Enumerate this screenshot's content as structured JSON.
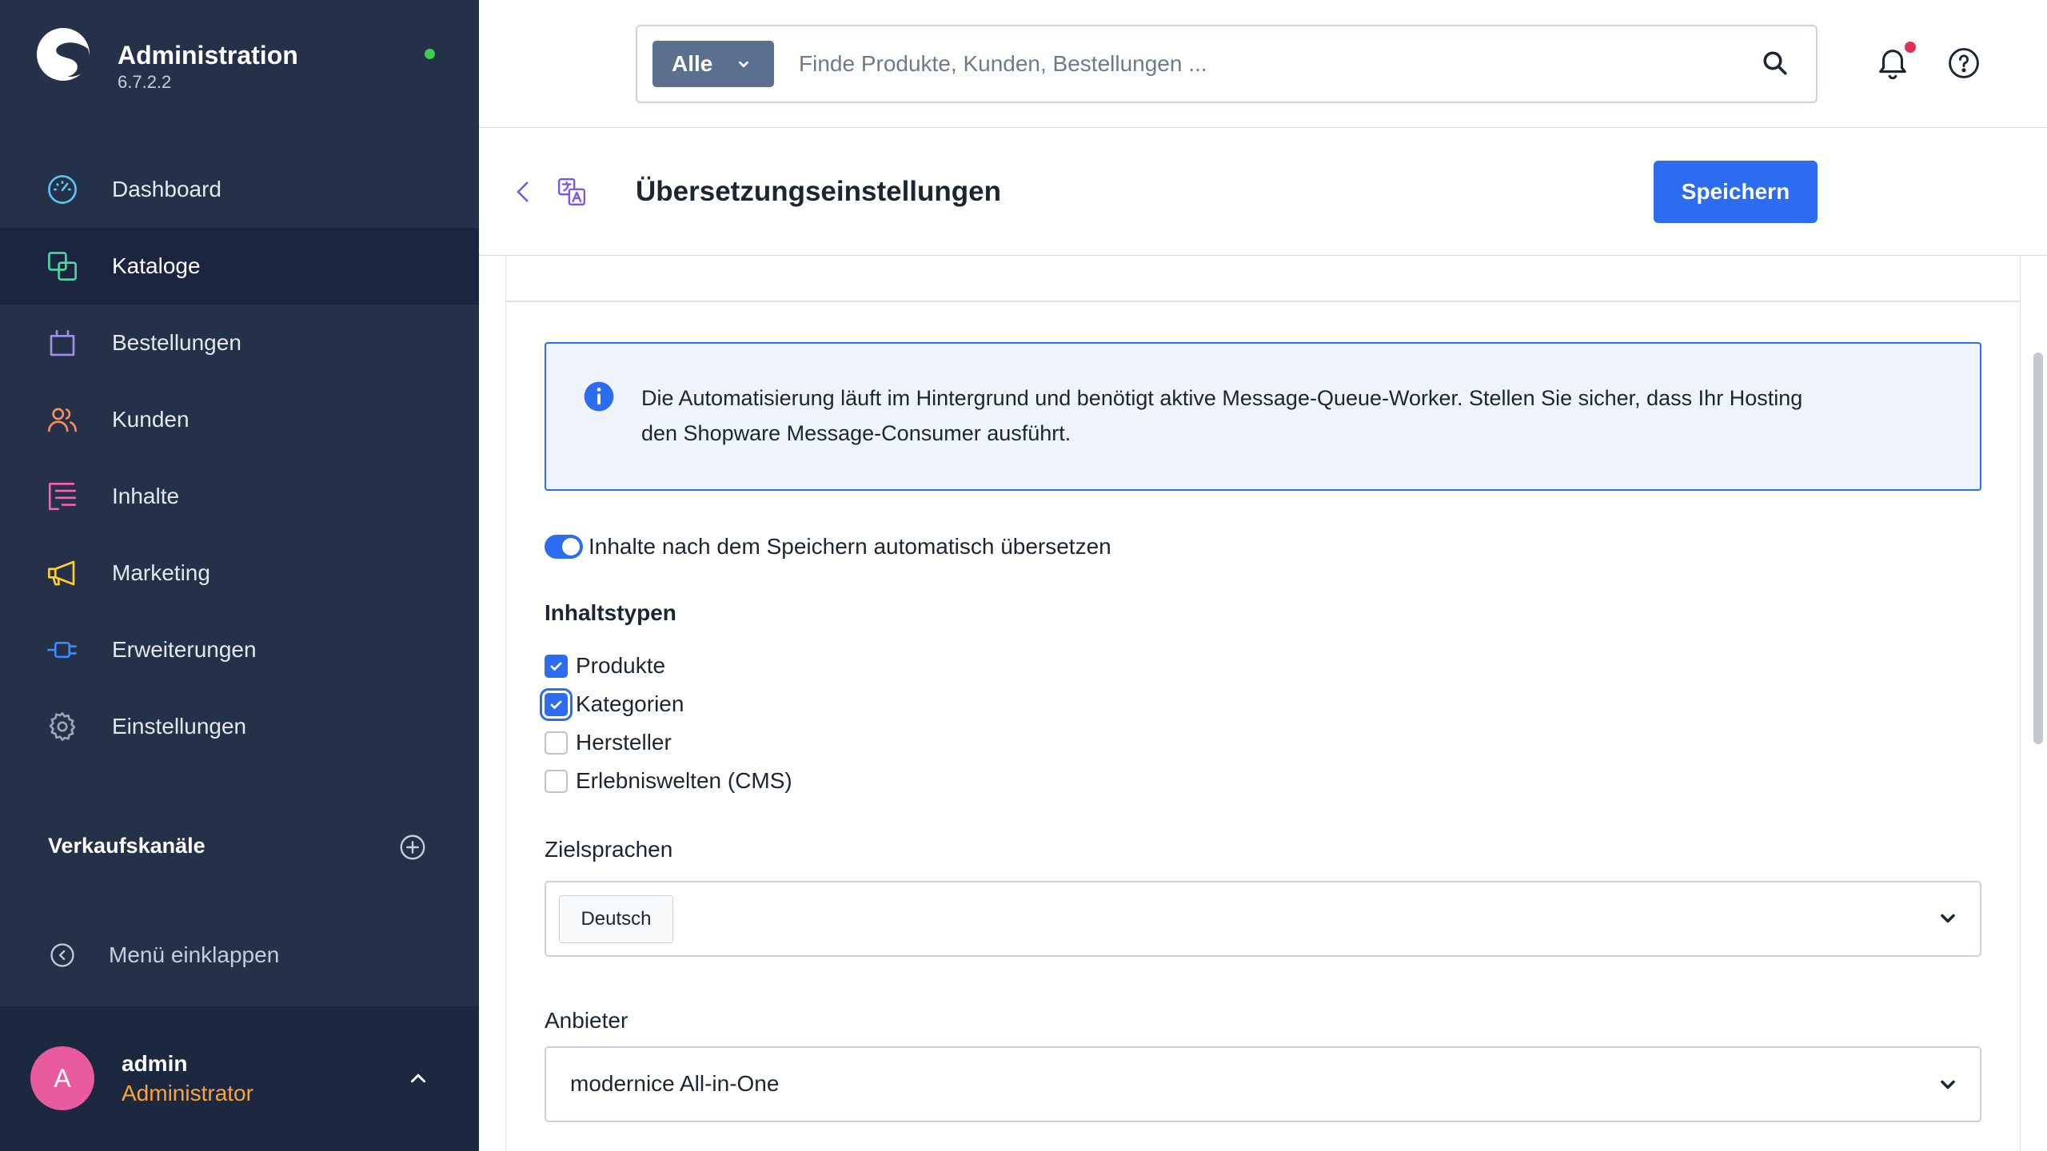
{
  "app": {
    "title": "Administration",
    "version": "6.7.2.2",
    "status_color": "#3ccf4e"
  },
  "sidebar": {
    "items": [
      {
        "label": "Dashboard",
        "icon": "dashboard-icon",
        "color": "#5bc8f2",
        "active": false
      },
      {
        "label": "Kataloge",
        "icon": "catalog-icon",
        "color": "#4fd8a0",
        "active": true
      },
      {
        "label": "Bestellungen",
        "icon": "shopping-bag-icon",
        "color": "#a48cf2",
        "active": false
      },
      {
        "label": "Kunden",
        "icon": "customers-icon",
        "color": "#ff8b5e",
        "active": false
      },
      {
        "label": "Inhalte",
        "icon": "content-icon",
        "color": "#ff5fae",
        "active": false
      },
      {
        "label": "Marketing",
        "icon": "megaphone-icon",
        "color": "#ffd12a",
        "active": false
      },
      {
        "label": "Erweiterungen",
        "icon": "plug-icon",
        "color": "#3b8cff",
        "active": false
      },
      {
        "label": "Einstellungen",
        "icon": "gear-icon",
        "color": "#9ba7b4",
        "active": false
      }
    ],
    "sales_channels": {
      "label": "Verkaufskanäle",
      "add_icon": "plus-circle-icon"
    },
    "collapse": {
      "label": "Menü einklappen",
      "icon": "chevron-left-circle-icon"
    },
    "user": {
      "initial": "A",
      "name": "admin",
      "role": "Administrator",
      "avatar_color": "#e85c9f",
      "role_color": "#f7a43a"
    }
  },
  "search": {
    "scope": "Alle",
    "placeholder": "Finde Produkte, Kunden, Bestellungen ...",
    "icon": "search-icon"
  },
  "header_icons": {
    "notifications": "bell-icon",
    "help": "help-icon",
    "notification_dot_color": "#e0304f"
  },
  "page": {
    "title": "Übersetzungseinstellungen",
    "save_label": "Speichern",
    "back_icon": "chevron-left-icon",
    "module_icon": "translate-icon",
    "primary_color": "#2b6cf0"
  },
  "info": {
    "icon": "info-icon",
    "lines": [
      "Die Automatisierung läuft im Hintergrund und benötigt aktive Message-Queue-Worker. Stellen Sie sicher, dass Ihr Hosting",
      "den Shopware Message-Consumer ausführt."
    ]
  },
  "auto_translate": {
    "label": "Inhalte nach dem Speichern automatisch übersetzen",
    "enabled": true
  },
  "content_types": {
    "title": "Inhaltstypen",
    "options": [
      {
        "label": "Produkte",
        "checked": true,
        "focused": false
      },
      {
        "label": "Kategorien",
        "checked": true,
        "focused": true
      },
      {
        "label": "Hersteller",
        "checked": false,
        "focused": false
      },
      {
        "label": "Erlebniswelten (CMS)",
        "checked": false,
        "focused": false
      }
    ]
  },
  "target_languages": {
    "label": "Zielsprachen",
    "selected": [
      "Deutsch"
    ]
  },
  "provider": {
    "label": "Anbieter",
    "value": "modernice All-in-One"
  }
}
